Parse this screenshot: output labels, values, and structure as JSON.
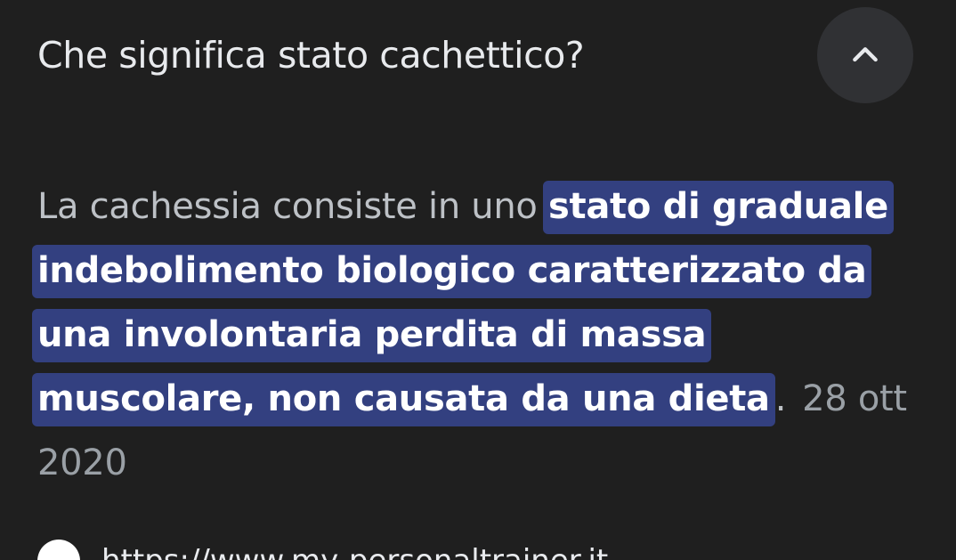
{
  "question": {
    "text": "Che significa stato cachettico?"
  },
  "collapse_button": {
    "icon": "chevron-up-icon"
  },
  "answer": {
    "lead": "La cachessia consiste in uno ",
    "highlight": "stato di graduale indebolimento biologico caratterizzato da una involontaria perdita di massa muscolare, non causata da una dieta",
    "period": ".",
    "date": "28 ott 2020"
  },
  "source": {
    "url_text": "https://www.my-personaltrainer.it"
  },
  "colors": {
    "background": "#1f1f1f",
    "highlight": "#334080",
    "button_bg": "#303134"
  }
}
